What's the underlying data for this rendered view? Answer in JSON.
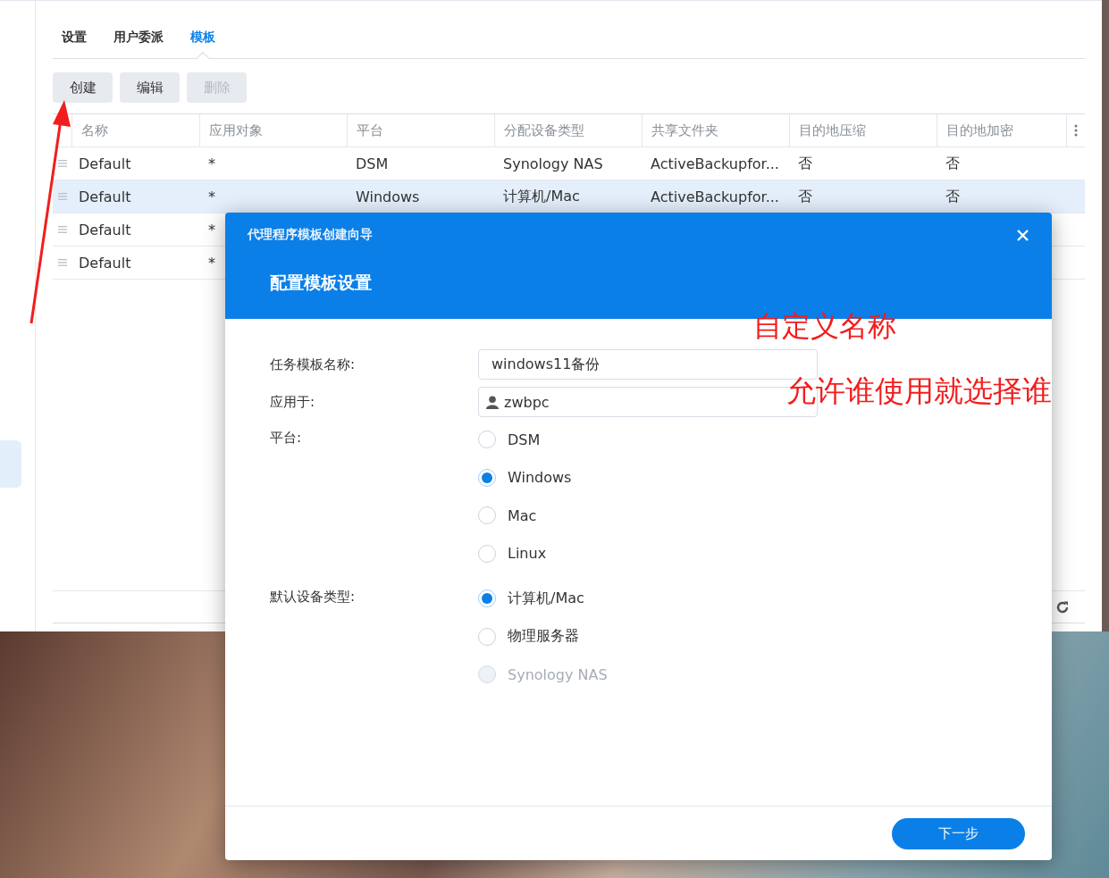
{
  "tabs": [
    {
      "label": "设置",
      "selected": false
    },
    {
      "label": "用户委派",
      "selected": false
    },
    {
      "label": "模板",
      "selected": true
    }
  ],
  "toolbar": [
    {
      "label": "创建",
      "disabled": false
    },
    {
      "label": "编辑",
      "disabled": false
    },
    {
      "label": "删除",
      "disabled": true
    }
  ],
  "table": {
    "columns": [
      "名称",
      "应用对象",
      "平台",
      "分配设备类型",
      "共享文件夹",
      "目的地压缩",
      "目的地加密"
    ],
    "rows": [
      {
        "selected": false,
        "cells": [
          "Default",
          "*",
          "DSM",
          "Synology NAS",
          "ActiveBackupfor...",
          "否",
          "否"
        ]
      },
      {
        "selected": true,
        "cells": [
          "Default",
          "*",
          "Windows",
          "计算机/Mac",
          "ActiveBackupfor...",
          "否",
          "否"
        ]
      },
      {
        "selected": false,
        "cells": [
          "Default",
          "*"
        ]
      },
      {
        "selected": false,
        "cells": [
          "Default",
          "*"
        ]
      }
    ]
  },
  "dialog": {
    "title": "代理程序模板创建向导",
    "subtitle": "配置模板设置",
    "fields": [
      {
        "kind": "text",
        "label": "任务模板名称:",
        "value": "windows11备份"
      },
      {
        "kind": "user",
        "label": "应用于:",
        "value": "zwbpc"
      },
      {
        "kind": "radio",
        "label": "平台:",
        "options": [
          {
            "label": "DSM",
            "selected": false,
            "disabled": false
          },
          {
            "label": "Windows",
            "selected": true,
            "disabled": false
          },
          {
            "label": "Mac",
            "selected": false,
            "disabled": false
          },
          {
            "label": "Linux",
            "selected": false,
            "disabled": false
          }
        ]
      },
      {
        "kind": "radio",
        "label": "默认设备类型:",
        "options": [
          {
            "label": "计算机/Mac",
            "selected": true,
            "disabled": false
          },
          {
            "label": "物理服务器",
            "selected": false,
            "disabled": false
          },
          {
            "label": "Synology NAS",
            "selected": false,
            "disabled": true
          }
        ]
      }
    ],
    "next_button": "下一步"
  },
  "annotations": [
    "自定义名称",
    "允许谁使用就选择谁"
  ]
}
